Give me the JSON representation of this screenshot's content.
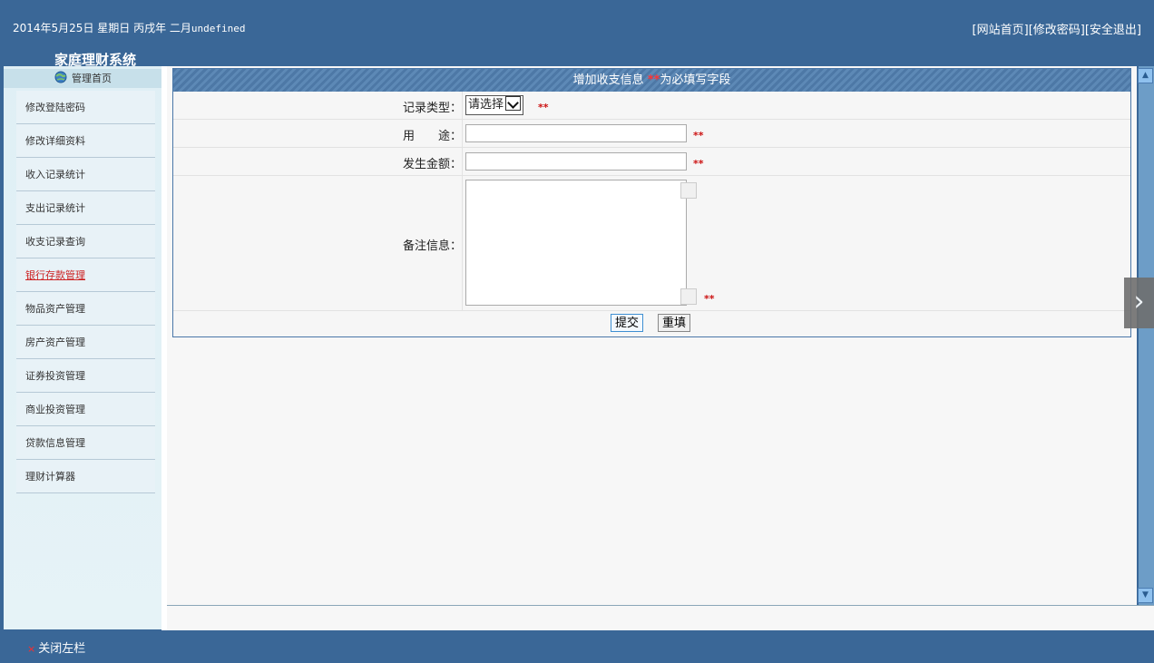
{
  "header": {
    "date_text": "2014年5月25日 星期日 丙戌年 二月",
    "date_suffix": "undefined",
    "system_title": "家庭理财系统",
    "links": [
      "[网站首页]",
      "[修改密码]",
      "[安全退出]"
    ]
  },
  "sidebar": {
    "header_label": "管理首页",
    "items": [
      {
        "label": "修改登陆密码"
      },
      {
        "label": "修改详细资料"
      },
      {
        "label": "收入记录统计"
      },
      {
        "label": "支出记录统计"
      },
      {
        "label": "收支记录查询"
      },
      {
        "label": "银行存款管理"
      },
      {
        "label": "物品资产管理"
      },
      {
        "label": "房产资产管理"
      },
      {
        "label": "证券投资管理"
      },
      {
        "label": "商业投资管理"
      },
      {
        "label": "贷款信息管理"
      },
      {
        "label": "理财计算器"
      }
    ],
    "active_index": 5
  },
  "form": {
    "title_prefix": "增加收支信息 ",
    "title_req": "**",
    "title_suffix": "为必填写字段",
    "required_mark": "**",
    "fields": {
      "type_label": "记录类型：",
      "type_selected": "请选择",
      "use_label": "用　　途：",
      "use_value": "",
      "amount_label": "发生金额：",
      "amount_value": "",
      "note_label": "备注信息：",
      "note_value": ""
    },
    "submit_label": "提交",
    "reset_label": "重填"
  },
  "footer": {
    "close_mark": "×",
    "close_label": "关闭左栏"
  },
  "colors": {
    "header_bg": "#3a6797",
    "required": "#cc1111",
    "active_link": "#cc2222"
  }
}
